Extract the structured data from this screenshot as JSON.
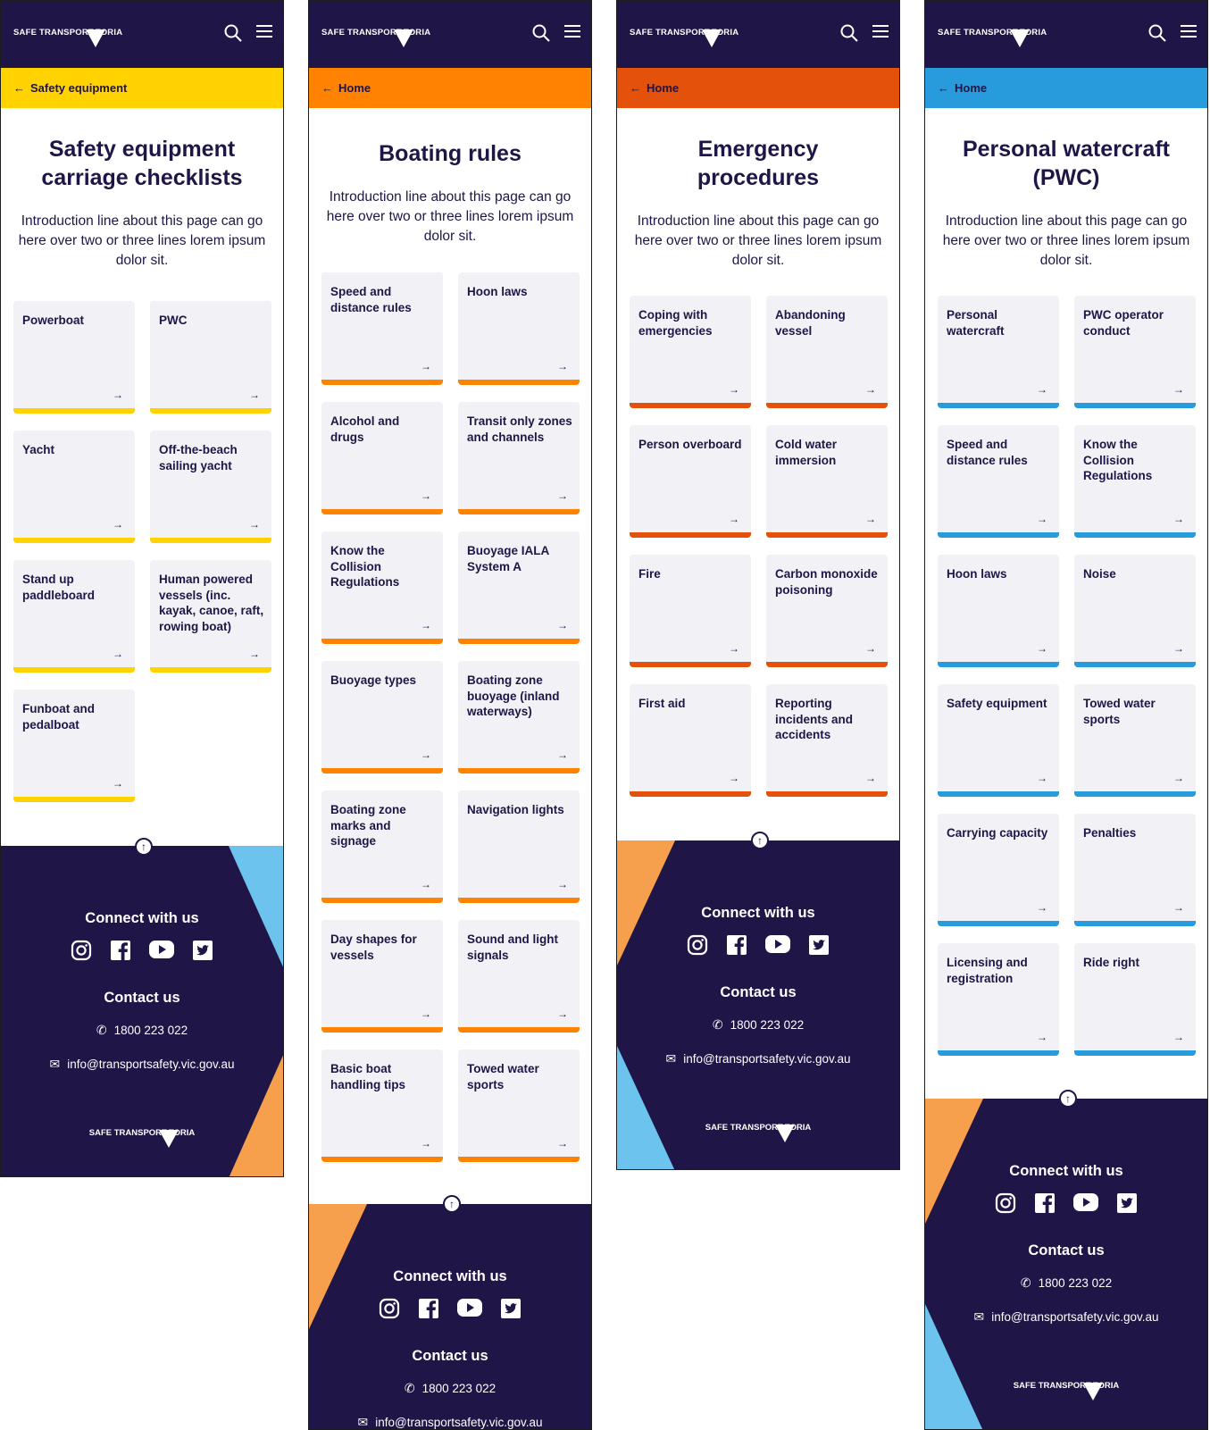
{
  "common": {
    "logo_left": "SAFE TRANSPORT",
    "logo_right": "TORIA",
    "logo_vi": "VIC",
    "connect_title": "Connect with us",
    "contact_title": "Contact us",
    "phone": "1800 223 022",
    "email": "info@transportsafety.vic.gov.au",
    "social_icons": [
      "instagram-icon",
      "facebook-icon",
      "youtube-icon",
      "twitter-icon"
    ],
    "back_to_top": "↑",
    "card_arrow": "→",
    "crumb_arrow": "←",
    "footer_color": "#201547",
    "light_blue": "#6cc4ee",
    "light_orange": "#f6a04d"
  },
  "screens": [
    {
      "crumb": "Safety equipment",
      "accent": "#ffd200",
      "title": "Safety equipment carriage checklists",
      "intro": "Introduction line about this page can go here over two or three lines lorem ipsum dolor sit.",
      "cards": [
        "Powerboat",
        "PWC",
        "Yacht",
        "Off-the-beach sailing yacht",
        "Stand up paddleboard",
        "Human powered vessels (inc. kayak, canoe, raft, rowing boat)",
        "Funboat and pedalboat"
      ]
    },
    {
      "crumb": "Home",
      "accent": "#ff8300",
      "title": "Boating rules",
      "intro": "Introduction line about this page can go here over two or three lines lorem ipsum dolor sit.",
      "cards": [
        "Speed and distance rules",
        "Hoon laws",
        "Alcohol and drugs",
        "Transit only zones and channels",
        "Know the Collision Regulations",
        "Buoyage IALA System A",
        "Buoyage types",
        "Boating zone buoyage (inland waterways)",
        "Boating zone marks and signage",
        "Navigation lights",
        "Day shapes for vessels",
        "Sound and light signals",
        "Basic boat handling tips",
        "Towed water sports"
      ]
    },
    {
      "crumb": "Home",
      "accent": "#e4510a",
      "title": "Emergency procedures",
      "intro": "Introduction line about this page can go here over two or three lines lorem ipsum dolor sit.",
      "cards": [
        "Coping with emergencies",
        "Abandoning vessel",
        "Person overboard",
        "Cold water immersion",
        "Fire",
        "Carbon monoxide poisoning",
        "First aid",
        "Reporting incidents and accidents"
      ]
    },
    {
      "crumb": "Home",
      "accent": "#279bdb",
      "title": "Personal watercraft (PWC)",
      "intro": "Introduction line about this page can go here over two or three lines lorem ipsum dolor sit.",
      "cards": [
        "Personal watercraft",
        "PWC operator conduct",
        "Speed and distance rules",
        "Know the Collision Regulations",
        "Hoon laws",
        "Noise",
        "Safety equipment",
        "Towed water sports",
        "Carrying capacity",
        "Penalties",
        "Licensing and registration",
        "Ride right"
      ]
    }
  ]
}
